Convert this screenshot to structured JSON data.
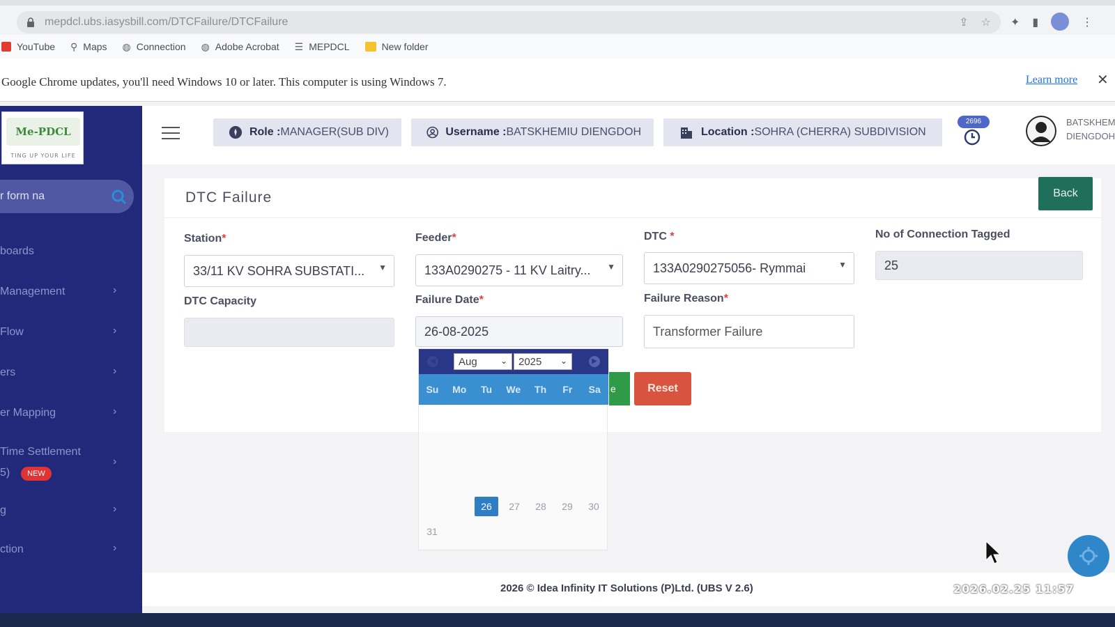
{
  "browser": {
    "url": "mepdcl.ubs.iasysbill.com/DTCFailure/DTCFailure",
    "bookmarks": [
      "YouTube",
      "Maps",
      "Connection",
      "Adobe Acrobat",
      "MEPDCL",
      "New folder"
    ],
    "infobar_message": "Google Chrome updates, you'll need Windows 10 or later. This computer is using Windows 7.",
    "learn_more": "Learn more"
  },
  "logo": {
    "mark": "Me-PDCL",
    "tagline": "TING UP YOUR LIFE"
  },
  "sidebar": {
    "search_placeholder": "r form na",
    "items": [
      {
        "label": "boards",
        "has_arrow": false
      },
      {
        "label": "Management",
        "has_arrow": true
      },
      {
        "label": "Flow",
        "has_arrow": true
      },
      {
        "label": "ers",
        "has_arrow": true
      },
      {
        "label": "er Mapping",
        "has_arrow": true
      },
      {
        "label": "Time Settlement",
        "sub": "5)",
        "badge": "NEW",
        "has_arrow": true
      },
      {
        "label": "g",
        "has_arrow": true
      },
      {
        "label": "ction",
        "has_arrow": true
      }
    ]
  },
  "header": {
    "role_label": "Role :",
    "role_value": "MANAGER(SUB DIV)",
    "username_label": "Username :",
    "username_value": "BATSKHEMIU DIENGDOH",
    "location_label": "Location :",
    "location_value": "SOHRA (CHERRA) SUBDIVISION",
    "notification_count": "2696",
    "user_line1": "BATSKHEMIU",
    "user_line2": "DIENGDOH"
  },
  "page": {
    "title": "DTC Failure",
    "back_label": "Back"
  },
  "form": {
    "station": {
      "label": "Station",
      "value": "33/11 KV SOHRA SUBSTATI..."
    },
    "feeder": {
      "label": "Feeder",
      "value": "133A0290275 - 11 KV Laitry..."
    },
    "dtc": {
      "label": "DTC ",
      "value": "133A0290275056- Rymmai"
    },
    "connections": {
      "label": "No of Connection Tagged",
      "value": "25"
    },
    "capacity": {
      "label": "DTC Capacity",
      "value": ""
    },
    "failure_date": {
      "label": "Failure Date",
      "value": "26-08-2025"
    },
    "failure_reason": {
      "label": "Failure Reason",
      "value": "Transformer Failure"
    },
    "save_label": "e",
    "reset_label": "Reset"
  },
  "datepicker": {
    "month": "Aug",
    "year": "2025",
    "weekdays": [
      "Su",
      "Mo",
      "Tu",
      "We",
      "Th",
      "Fr",
      "Sa"
    ],
    "visible_days": [
      "26",
      "27",
      "28",
      "29",
      "30",
      "31"
    ],
    "selected_day": "26"
  },
  "footer": {
    "text": "2026 © Idea Infinity IT Solutions (P)Ltd. (UBS V 2.6)"
  },
  "overlay_stamp": "2026.02.25 11:57",
  "colors": {
    "sidebar": "#23297a",
    "back_button": "#1f6f5c",
    "reset_button": "#d9543f",
    "calendar_header": "#2a3788",
    "calendar_days": "#3a8fd0",
    "required": "#e04040"
  }
}
